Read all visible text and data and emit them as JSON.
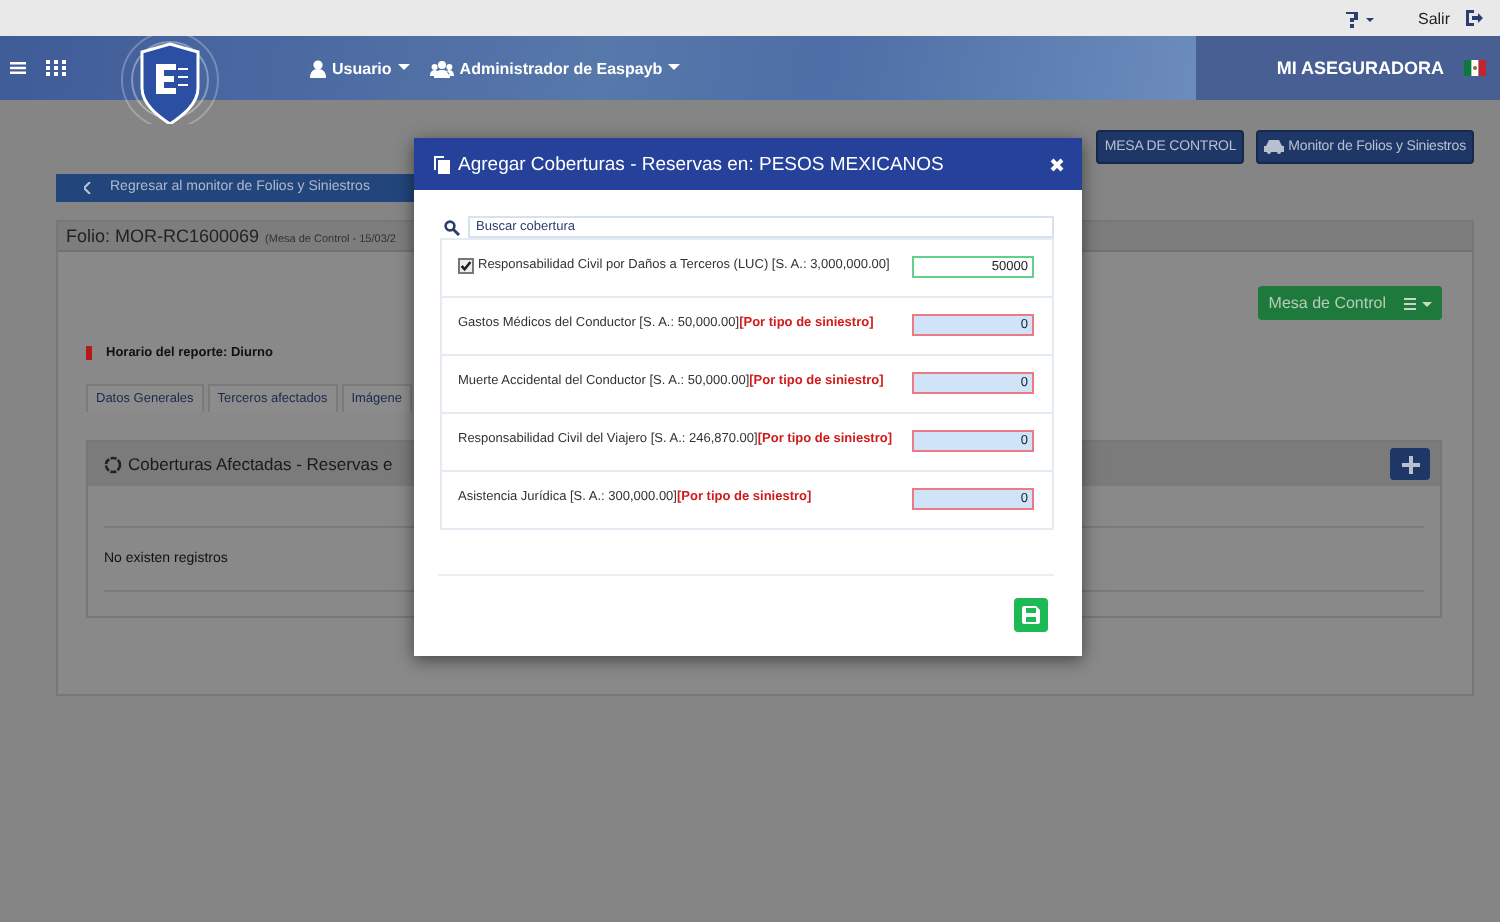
{
  "topbar": {
    "logout": "Salir"
  },
  "header": {
    "menus": [
      {
        "label": "Usuario",
        "kind": "user"
      },
      {
        "label": "Administrador de Easpayb",
        "kind": "group"
      }
    ],
    "brand": "MI ASEGURADORA"
  },
  "actions": [
    {
      "label": "MESA DE CONTROL"
    },
    {
      "label": "Monitor de Folios y Siniestros"
    }
  ],
  "back_link": "Regresar al monitor de Folios y Siniestros",
  "folio": {
    "title": "Folio: MOR-RC1600069",
    "subtitle": "(Mesa de Control - 15/03/2"
  },
  "mesa_button": "Mesa de Control",
  "report_time": "Horario del reporte: Diurno",
  "tabs": [
    {
      "label": "Datos Generales",
      "selected": false
    },
    {
      "label": "Terceros afectados",
      "selected": false
    },
    {
      "label": "Imágene",
      "selected": false
    }
  ],
  "coverage_panel": {
    "title": "Coberturas Afectadas - Reservas e",
    "empty": "No existen registros"
  },
  "modal": {
    "title": "Agregar Coberturas - Reservas en: PESOS MEXICANOS",
    "search": {
      "placeholder": "Buscar cobertura"
    },
    "items": [
      {
        "kind": "checkbox",
        "checked": true,
        "name": "Responsabilidad Civil por Daños a Terceros (LUC) [S. A.: 3,000,000.00]",
        "value": "50000",
        "invalid": false
      },
      {
        "kind": "plain",
        "name": "Gastos Médicos del Conductor [S. A.: 50,000.00]",
        "note": "[Por tipo de siniestro]",
        "value": "0",
        "invalid": true
      },
      {
        "kind": "plain",
        "name": "Muerte Accidental del Conductor [S. A.: 50,000.00]",
        "note": "[Por tipo de siniestro]",
        "value": "0",
        "invalid": true
      },
      {
        "kind": "plain",
        "name": "Responsabilidad Civil del Viajero [S. A.: 246,870.00]",
        "note": "[Por tipo de siniestro]",
        "value": "0",
        "invalid": true
      },
      {
        "kind": "plain",
        "name": "Asistencia Jurídica [S. A.: 300,000.00]",
        "note": "[Por tipo de siniestro]",
        "value": "0",
        "invalid": true
      }
    ]
  }
}
